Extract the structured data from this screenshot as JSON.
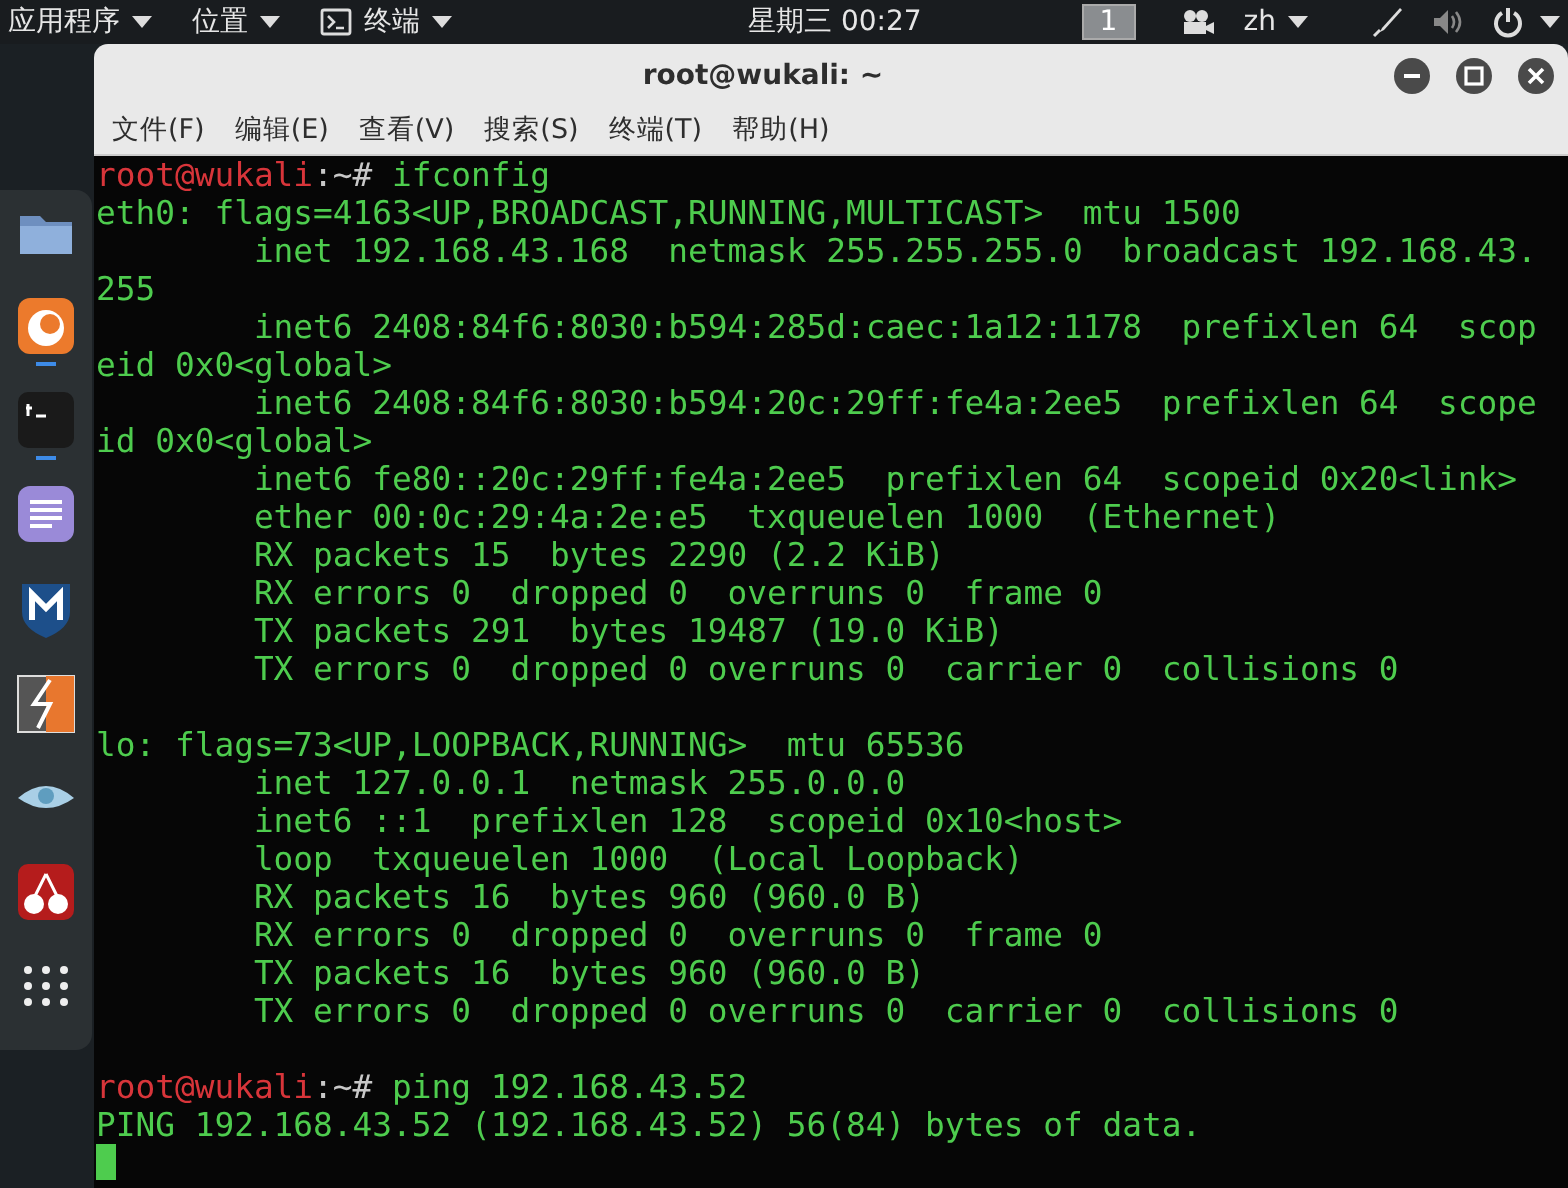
{
  "top_bar": {
    "applications": "应用程序",
    "places": "位置",
    "active_app": "终端",
    "clock": "星期三 00:27",
    "workspace": "1",
    "language": "zh"
  },
  "dock": {
    "apps": [
      {
        "kind": "folder",
        "running": false
      },
      {
        "kind": "browser",
        "running": true
      },
      {
        "kind": "terminal",
        "running": true
      },
      {
        "kind": "editor",
        "running": false
      },
      {
        "kind": "shield",
        "running": false
      },
      {
        "kind": "bolt",
        "running": false
      },
      {
        "kind": "eye",
        "running": false
      },
      {
        "kind": "cherry",
        "running": false
      },
      {
        "kind": "grid",
        "running": false
      }
    ]
  },
  "window": {
    "title": "root@wukali: ~",
    "menu": [
      "文件(F)",
      "编辑(E)",
      "查看(V)",
      "搜索(S)",
      "终端(T)",
      "帮助(H)"
    ]
  },
  "terminal": {
    "lines": [
      {
        "kind": "prompt",
        "user": "root@wukali",
        "path": ":~# ",
        "command": "ifconfig"
      },
      {
        "kind": "output",
        "text": "eth0: flags=4163<UP,BROADCAST,RUNNING,MULTICAST>  mtu 1500"
      },
      {
        "kind": "output",
        "text": "        inet 192.168.43.168  netmask 255.255.255.0  broadcast 192.168.43."
      },
      {
        "kind": "output",
        "text": "255"
      },
      {
        "kind": "output",
        "text": "        inet6 2408:84f6:8030:b594:285d:caec:1a12:1178  prefixlen 64  scop"
      },
      {
        "kind": "output",
        "text": "eid 0x0<global>"
      },
      {
        "kind": "output",
        "text": "        inet6 2408:84f6:8030:b594:20c:29ff:fe4a:2ee5  prefixlen 64  scope"
      },
      {
        "kind": "output",
        "text": "id 0x0<global>"
      },
      {
        "kind": "output",
        "text": "        inet6 fe80::20c:29ff:fe4a:2ee5  prefixlen 64  scopeid 0x20<link>"
      },
      {
        "kind": "output",
        "text": "        ether 00:0c:29:4a:2e:e5  txqueuelen 1000  (Ethernet)"
      },
      {
        "kind": "output",
        "text": "        RX packets 15  bytes 2290 (2.2 KiB)"
      },
      {
        "kind": "output",
        "text": "        RX errors 0  dropped 0  overruns 0  frame 0"
      },
      {
        "kind": "output",
        "text": "        TX packets 291  bytes 19487 (19.0 KiB)"
      },
      {
        "kind": "output",
        "text": "        TX errors 0  dropped 0 overruns 0  carrier 0  collisions 0"
      },
      {
        "kind": "blank"
      },
      {
        "kind": "output",
        "text": "lo: flags=73<UP,LOOPBACK,RUNNING>  mtu 65536"
      },
      {
        "kind": "output",
        "text": "        inet 127.0.0.1  netmask 255.0.0.0"
      },
      {
        "kind": "output",
        "text": "        inet6 ::1  prefixlen 128  scopeid 0x10<host>"
      },
      {
        "kind": "output",
        "text": "        loop  txqueuelen 1000  (Local Loopback)"
      },
      {
        "kind": "output",
        "text": "        RX packets 16  bytes 960 (960.0 B)"
      },
      {
        "kind": "output",
        "text": "        RX errors 0  dropped 0  overruns 0  frame 0"
      },
      {
        "kind": "output",
        "text": "        TX packets 16  bytes 960 (960.0 B)"
      },
      {
        "kind": "output",
        "text": "        TX errors 0  dropped 0 overruns 0  carrier 0  collisions 0"
      },
      {
        "kind": "blank"
      },
      {
        "kind": "prompt",
        "user": "root@wukali",
        "path": ":~# ",
        "command": "ping 192.168.43.52"
      },
      {
        "kind": "output",
        "text": "PING 192.168.43.52 (192.168.43.52) 56(84) bytes of data."
      },
      {
        "kind": "cursor"
      }
    ]
  }
}
